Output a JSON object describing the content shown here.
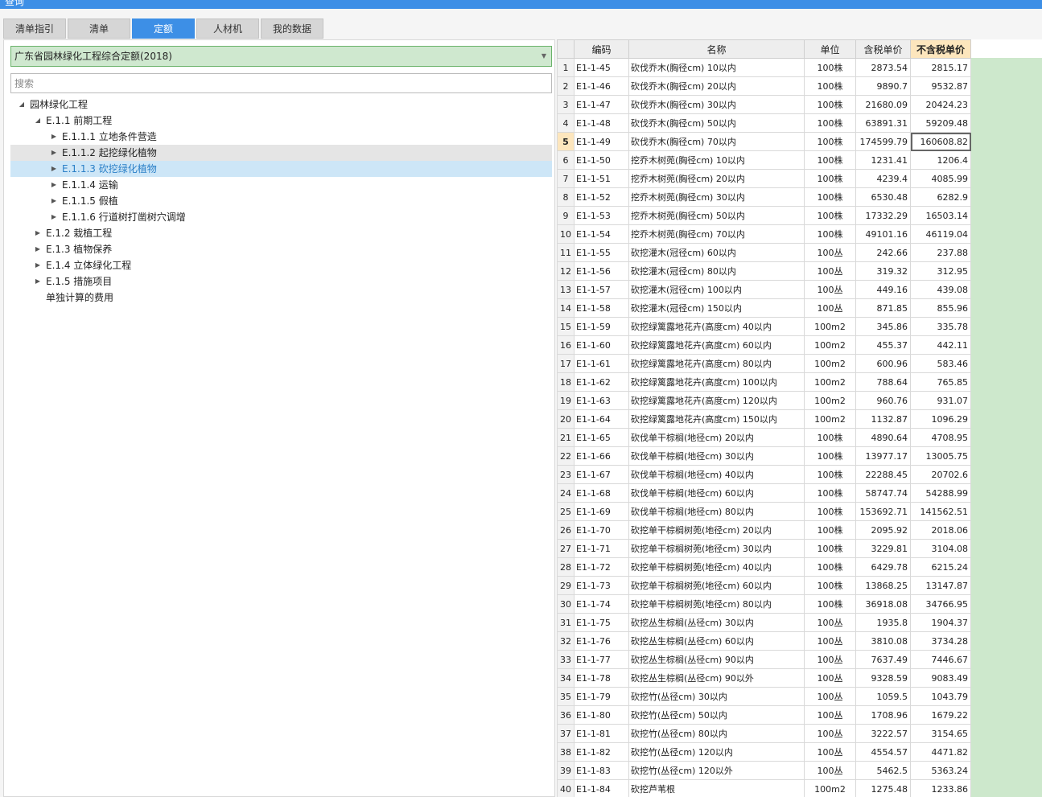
{
  "window_title": "查询",
  "tabs": [
    {
      "label": "清单指引"
    },
    {
      "label": "清单"
    },
    {
      "label": "定额"
    },
    {
      "label": "人材机"
    },
    {
      "label": "我的数据"
    }
  ],
  "library_select": {
    "value": "广东省园林绿化工程综合定额(2018)"
  },
  "search": {
    "placeholder": "搜索"
  },
  "tree": [
    {
      "label": "园林绿化工程",
      "level": 0,
      "state": "expanded"
    },
    {
      "label": "E.1.1 前期工程",
      "level": 1,
      "state": "expanded"
    },
    {
      "label": "E.1.1.1 立地条件营造",
      "level": 2,
      "state": "collapsed"
    },
    {
      "label": "E.1.1.2 起挖绿化植物",
      "level": 2,
      "state": "collapsed",
      "hover": true
    },
    {
      "label": "E.1.1.3 砍挖绿化植物",
      "level": 2,
      "state": "collapsed",
      "selected": true
    },
    {
      "label": "E.1.1.4 运输",
      "level": 2,
      "state": "collapsed"
    },
    {
      "label": "E.1.1.5 假植",
      "level": 2,
      "state": "collapsed"
    },
    {
      "label": "E.1.1.6 行道树打凿树穴调增",
      "level": 2,
      "state": "collapsed"
    },
    {
      "label": "E.1.2 栽植工程",
      "level": 1,
      "state": "collapsed"
    },
    {
      "label": "E.1.3 植物保养",
      "level": 1,
      "state": "collapsed"
    },
    {
      "label": "E.1.4 立体绿化工程",
      "level": 1,
      "state": "collapsed"
    },
    {
      "label": "E.1.5 措施项目",
      "level": 1,
      "state": "collapsed"
    },
    {
      "label": "单独计算的费用",
      "level": 1,
      "state": "leaf"
    }
  ],
  "grid": {
    "columns": [
      "编码",
      "名称",
      "单位",
      "含税单价",
      "不含税单价"
    ],
    "active_row": 5,
    "rows": [
      [
        "1",
        "E1-1-45",
        "砍伐乔木(胸径cm) 10以内",
        "100株",
        "2873.54",
        "2815.17"
      ],
      [
        "2",
        "E1-1-46",
        "砍伐乔木(胸径cm) 20以内",
        "100株",
        "9890.7",
        "9532.87"
      ],
      [
        "3",
        "E1-1-47",
        "砍伐乔木(胸径cm) 30以内",
        "100株",
        "21680.09",
        "20424.23"
      ],
      [
        "4",
        "E1-1-48",
        "砍伐乔木(胸径cm) 50以内",
        "100株",
        "63891.31",
        "59209.48"
      ],
      [
        "5",
        "E1-1-49",
        "砍伐乔木(胸径cm) 70以内",
        "100株",
        "174599.79",
        "160608.82"
      ],
      [
        "6",
        "E1-1-50",
        "挖乔木树蔸(胸径cm) 10以内",
        "100株",
        "1231.41",
        "1206.4"
      ],
      [
        "7",
        "E1-1-51",
        "挖乔木树蔸(胸径cm) 20以内",
        "100株",
        "4239.4",
        "4085.99"
      ],
      [
        "8",
        "E1-1-52",
        "挖乔木树蔸(胸径cm) 30以内",
        "100株",
        "6530.48",
        "6282.9"
      ],
      [
        "9",
        "E1-1-53",
        "挖乔木树蔸(胸径cm) 50以内",
        "100株",
        "17332.29",
        "16503.14"
      ],
      [
        "10",
        "E1-1-54",
        "挖乔木树蔸(胸径cm) 70以内",
        "100株",
        "49101.16",
        "46119.04"
      ],
      [
        "11",
        "E1-1-55",
        "砍挖灌木(冠径cm) 60以内",
        "100丛",
        "242.66",
        "237.88"
      ],
      [
        "12",
        "E1-1-56",
        "砍挖灌木(冠径cm) 80以内",
        "100丛",
        "319.32",
        "312.95"
      ],
      [
        "13",
        "E1-1-57",
        "砍挖灌木(冠径cm) 100以内",
        "100丛",
        "449.16",
        "439.08"
      ],
      [
        "14",
        "E1-1-58",
        "砍挖灌木(冠径cm) 150以内",
        "100丛",
        "871.85",
        "855.96"
      ],
      [
        "15",
        "E1-1-59",
        "砍挖绿篱露地花卉(高度cm) 40以内",
        "100m2",
        "345.86",
        "335.78"
      ],
      [
        "16",
        "E1-1-60",
        "砍挖绿篱露地花卉(高度cm) 60以内",
        "100m2",
        "455.37",
        "442.11"
      ],
      [
        "17",
        "E1-1-61",
        "砍挖绿篱露地花卉(高度cm) 80以内",
        "100m2",
        "600.96",
        "583.46"
      ],
      [
        "18",
        "E1-1-62",
        "砍挖绿篱露地花卉(高度cm) 100以内",
        "100m2",
        "788.64",
        "765.85"
      ],
      [
        "19",
        "E1-1-63",
        "砍挖绿篱露地花卉(高度cm) 120以内",
        "100m2",
        "960.76",
        "931.07"
      ],
      [
        "20",
        "E1-1-64",
        "砍挖绿篱露地花卉(高度cm) 150以内",
        "100m2",
        "1132.87",
        "1096.29"
      ],
      [
        "21",
        "E1-1-65",
        "砍伐单干棕榈(地径cm) 20以内",
        "100株",
        "4890.64",
        "4708.95"
      ],
      [
        "22",
        "E1-1-66",
        "砍伐单干棕榈(地径cm) 30以内",
        "100株",
        "13977.17",
        "13005.75"
      ],
      [
        "23",
        "E1-1-67",
        "砍伐单干棕榈(地径cm) 40以内",
        "100株",
        "22288.45",
        "20702.6"
      ],
      [
        "24",
        "E1-1-68",
        "砍伐单干棕榈(地径cm) 60以内",
        "100株",
        "58747.74",
        "54288.99"
      ],
      [
        "25",
        "E1-1-69",
        "砍伐单干棕榈(地径cm) 80以内",
        "100株",
        "153692.71",
        "141562.51"
      ],
      [
        "26",
        "E1-1-70",
        "砍挖单干棕榈树蔸(地径cm) 20以内",
        "100株",
        "2095.92",
        "2018.06"
      ],
      [
        "27",
        "E1-1-71",
        "砍挖单干棕榈树蔸(地径cm) 30以内",
        "100株",
        "3229.81",
        "3104.08"
      ],
      [
        "28",
        "E1-1-72",
        "砍挖单干棕榈树蔸(地径cm) 40以内",
        "100株",
        "6429.78",
        "6215.24"
      ],
      [
        "29",
        "E1-1-73",
        "砍挖单干棕榈树蔸(地径cm) 60以内",
        "100株",
        "13868.25",
        "13147.87"
      ],
      [
        "30",
        "E1-1-74",
        "砍挖单干棕榈树蔸(地径cm) 80以内",
        "100株",
        "36918.08",
        "34766.95"
      ],
      [
        "31",
        "E1-1-75",
        "砍挖丛生棕榈(丛径cm) 30以内",
        "100丛",
        "1935.8",
        "1904.37"
      ],
      [
        "32",
        "E1-1-76",
        "砍挖丛生棕榈(丛径cm) 60以内",
        "100丛",
        "3810.08",
        "3734.28"
      ],
      [
        "33",
        "E1-1-77",
        "砍挖丛生棕榈(丛径cm) 90以内",
        "100丛",
        "7637.49",
        "7446.67"
      ],
      [
        "34",
        "E1-1-78",
        "砍挖丛生棕榈(丛径cm) 90以外",
        "100丛",
        "9328.59",
        "9083.49"
      ],
      [
        "35",
        "E1-1-79",
        "砍挖竹(丛径cm) 30以内",
        "100丛",
        "1059.5",
        "1043.79"
      ],
      [
        "36",
        "E1-1-80",
        "砍挖竹(丛径cm) 50以内",
        "100丛",
        "1708.96",
        "1679.22"
      ],
      [
        "37",
        "E1-1-81",
        "砍挖竹(丛径cm) 80以内",
        "100丛",
        "3222.57",
        "3154.65"
      ],
      [
        "38",
        "E1-1-82",
        "砍挖竹(丛径cm) 120以内",
        "100丛",
        "4554.57",
        "4471.82"
      ],
      [
        "39",
        "E1-1-83",
        "砍挖竹(丛径cm) 120以外",
        "100丛",
        "5462.5",
        "5363.24"
      ],
      [
        "40",
        "E1-1-84",
        "砍挖芦苇根",
        "100m2",
        "1275.48",
        "1233.86"
      ]
    ]
  }
}
